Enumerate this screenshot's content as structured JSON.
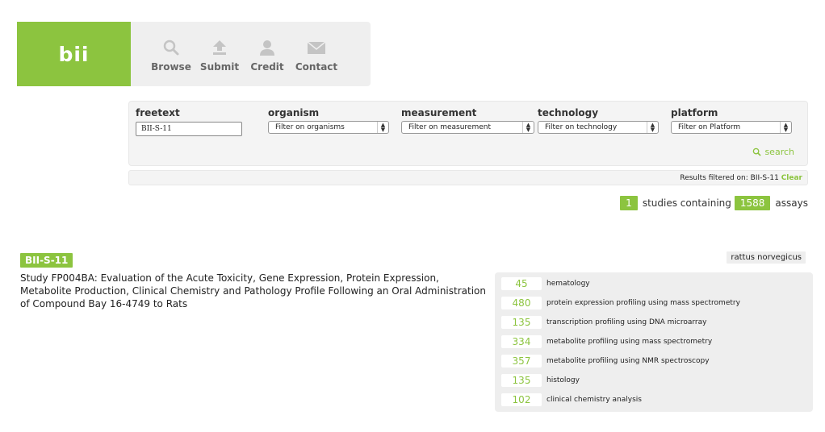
{
  "header": {
    "logo_text": "bii",
    "logo_color": "#8cc43f",
    "nav": [
      {
        "label": "Browse",
        "icon": "search-icon"
      },
      {
        "label": "Submit",
        "icon": "upload-icon"
      },
      {
        "label": "Credit",
        "icon": "user-icon"
      },
      {
        "label": "Contact",
        "icon": "envelope-icon"
      }
    ]
  },
  "filters": {
    "freetext": {
      "label": "freetext",
      "value": "BII-S-11"
    },
    "organism": {
      "label": "organism",
      "selected": "Filter on organisms"
    },
    "measurement": {
      "label": "measurement",
      "selected": "Filter on measurement"
    },
    "technology": {
      "label": "technology",
      "selected": "Filter on technology"
    },
    "platform": {
      "label": "platform",
      "selected": "Filter on Platform"
    },
    "search_label": "search"
  },
  "results": {
    "filtered_text": "Results filtered on: BII-S-11",
    "clear_label": "Clear"
  },
  "summary": {
    "studies_count": "1",
    "studies_text": "studies containing",
    "assays_count": "1588",
    "assays_text": "assays"
  },
  "study": {
    "id": "BII-S-11",
    "title": "Study FP004BA: Evaluation of the Acute Toxicity, Gene Expression, Protein Expression, Metabolite Production, Clinical Chemistry and Pathology Profile Following an Oral Administration of Compound Bay 16-4749 to Rats",
    "organism": "rattus norvegicus",
    "assays": [
      {
        "count": "45",
        "name": "hematology"
      },
      {
        "count": "480",
        "name": "protein expression profiling using mass spectrometry"
      },
      {
        "count": "135",
        "name": "transcription profiling using DNA microarray"
      },
      {
        "count": "334",
        "name": "metabolite profiling using mass spectrometry"
      },
      {
        "count": "357",
        "name": "metabolite profiling using NMR spectroscopy"
      },
      {
        "count": "135",
        "name": "histology"
      },
      {
        "count": "102",
        "name": "clinical chemistry analysis"
      }
    ]
  }
}
